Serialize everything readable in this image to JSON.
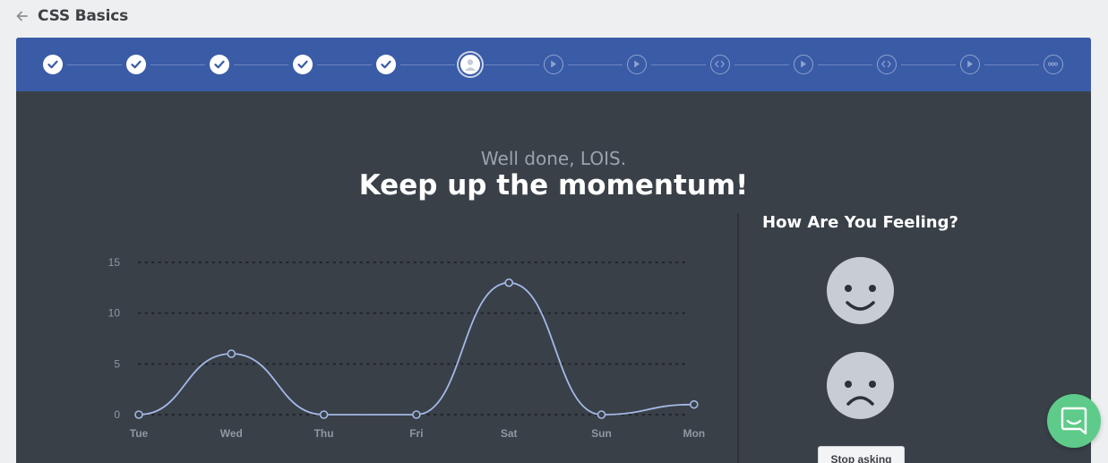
{
  "header": {
    "title": "CSS Basics"
  },
  "progress": {
    "steps": [
      {
        "status": "done",
        "icon": "check-icon"
      },
      {
        "status": "done",
        "icon": "check-icon"
      },
      {
        "status": "done",
        "icon": "check-icon"
      },
      {
        "status": "done",
        "icon": "check-icon"
      },
      {
        "status": "done",
        "icon": "check-icon"
      },
      {
        "status": "current",
        "icon": "user-icon"
      },
      {
        "status": "todo",
        "icon": "play-icon"
      },
      {
        "status": "todo",
        "icon": "play-icon"
      },
      {
        "status": "todo",
        "icon": "code-icon"
      },
      {
        "status": "todo",
        "icon": "play-icon"
      },
      {
        "status": "todo",
        "icon": "code-icon"
      },
      {
        "status": "todo",
        "icon": "play-icon"
      },
      {
        "status": "todo",
        "icon": "more-icon"
      }
    ]
  },
  "greeting": {
    "subtitle": "Well done, LOIS.",
    "title": "Keep up the momentum!"
  },
  "chart_data": {
    "type": "line",
    "categories": [
      "Tue",
      "Wed",
      "Thu",
      "Fri",
      "Sat",
      "Sun",
      "Mon"
    ],
    "values": [
      0,
      6,
      0,
      0,
      13,
      0,
      1
    ],
    "ylim": [
      0,
      15
    ],
    "yticks": [
      "0",
      "5",
      "10",
      "15"
    ],
    "grid": true,
    "colors": {
      "line": "#a4b8e6",
      "grid": "#1f242a",
      "label": "#8f97a1"
    }
  },
  "feeling": {
    "title": "How Are You Feeling?",
    "happy_icon": "happy-face-icon",
    "sad_icon": "sad-face-icon",
    "stop_label": "Stop asking"
  },
  "colors": {
    "progress_bar": "#3a5ba6",
    "card": "#394048",
    "chat": "#5ecb8a"
  }
}
